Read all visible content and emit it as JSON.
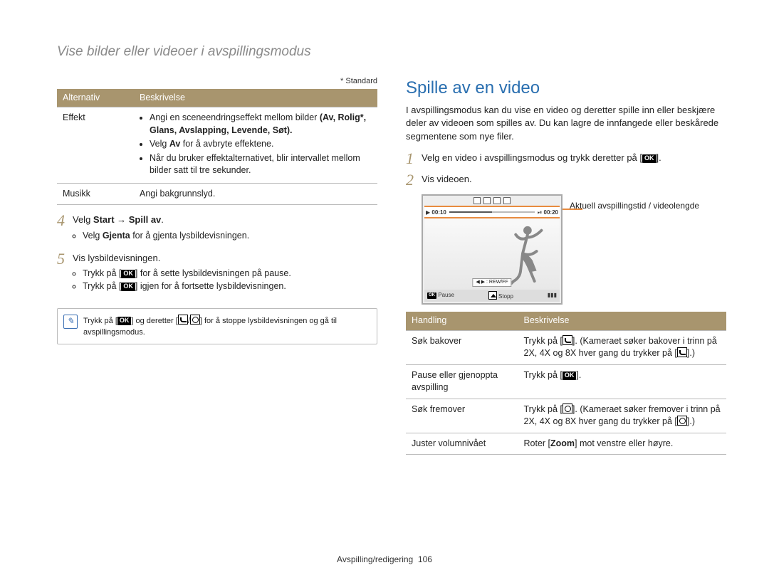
{
  "breadcrumb": "Vise bilder eller videoer i avspillingsmodus",
  "left": {
    "standard_note": "* Standard",
    "table_headers": {
      "opt": "Alternativ",
      "desc": "Beskrivelse"
    },
    "rows": {
      "effekt": {
        "label": "Effekt",
        "b1": "Angi en sceneendringseffekt mellom bilder",
        "b1_bold": "(Av, Rolig*, Glans, Avslapping, Levende, Søt).",
        "b2_pre": "Velg ",
        "b2_bold": "Av",
        "b2_post": " for å avbryte effektene.",
        "b3": "Når du bruker effektalternativet, blir intervallet mellom bilder satt til tre sekunder."
      },
      "musikk": {
        "label": "Musikk",
        "desc": "Angi bakgrunnslyd."
      }
    },
    "steps": {
      "s4": {
        "num": "4",
        "pre": "Velg ",
        "bold": "Start → Spill av",
        "post": ".",
        "bul_pre": "Velg ",
        "bul_bold": "Gjenta",
        "bul_post": " for å gjenta lysbildevisningen."
      },
      "s5": {
        "num": "5",
        "text": "Vis lysbildevisningen.",
        "bul1_pre": "Trykk på [",
        "bul1_post": "] for å sette lysbildevisningen på pause.",
        "bul2_pre": "Trykk på [",
        "bul2_post": "] igjen for å fortsette lysbildevisningen."
      }
    },
    "note": {
      "pre": "Trykk på [",
      "mid1": "] og deretter [",
      "mid2": "/",
      "post": "] for å stoppe lysbildevisningen og gå til avspillingsmodus."
    }
  },
  "right": {
    "heading": "Spille av en video",
    "intro": "I avspillingsmodus kan du vise en video og deretter spille inn eller beskjære deler av videoen som spilles av. Du kan lagre de innfangede eller beskårede segmentene som nye filer.",
    "steps": {
      "s1": {
        "num": "1",
        "pre": "Velg en video i avspillingsmodus og trykk deretter på [",
        "post": "]."
      },
      "s2": {
        "num": "2",
        "text": "Vis videoen."
      }
    },
    "screen": {
      "time_left": "00:10",
      "time_right": "00:20",
      "rewff": "◀ ▶ : REW/FF",
      "pause": "Pause",
      "stop": "Stopp"
    },
    "caption": "Aktuell avspillingstid / videolengde",
    "table_headers": {
      "action": "Handling",
      "desc": "Beskrivelse"
    },
    "rows": {
      "back": {
        "label": "Søk bakover",
        "d_pre": "Trykk på [",
        "d_mid": "]. (Kameraet søker bakover i trinn på 2X, 4X og 8X hver gang du trykker på [",
        "d_post": "].)"
      },
      "pause": {
        "label": "Pause eller gjenoppta avspilling",
        "d_pre": "Trykk på [",
        "d_post": "]."
      },
      "fwd": {
        "label": "Søk fremover",
        "d_pre": "Trykk på [",
        "d_mid": "]. (Kameraet søker fremover i trinn på 2X, 4X og 8X hver gang du trykker på [",
        "d_post": "].)"
      },
      "vol": {
        "label": "Juster volumnivået",
        "d_pre": "Roter [",
        "d_bold": "Zoom",
        "d_post": "] mot venstre eller høyre."
      }
    }
  },
  "footer": {
    "section": "Avspilling/redigering",
    "page": "106"
  },
  "ok_label": "OK"
}
